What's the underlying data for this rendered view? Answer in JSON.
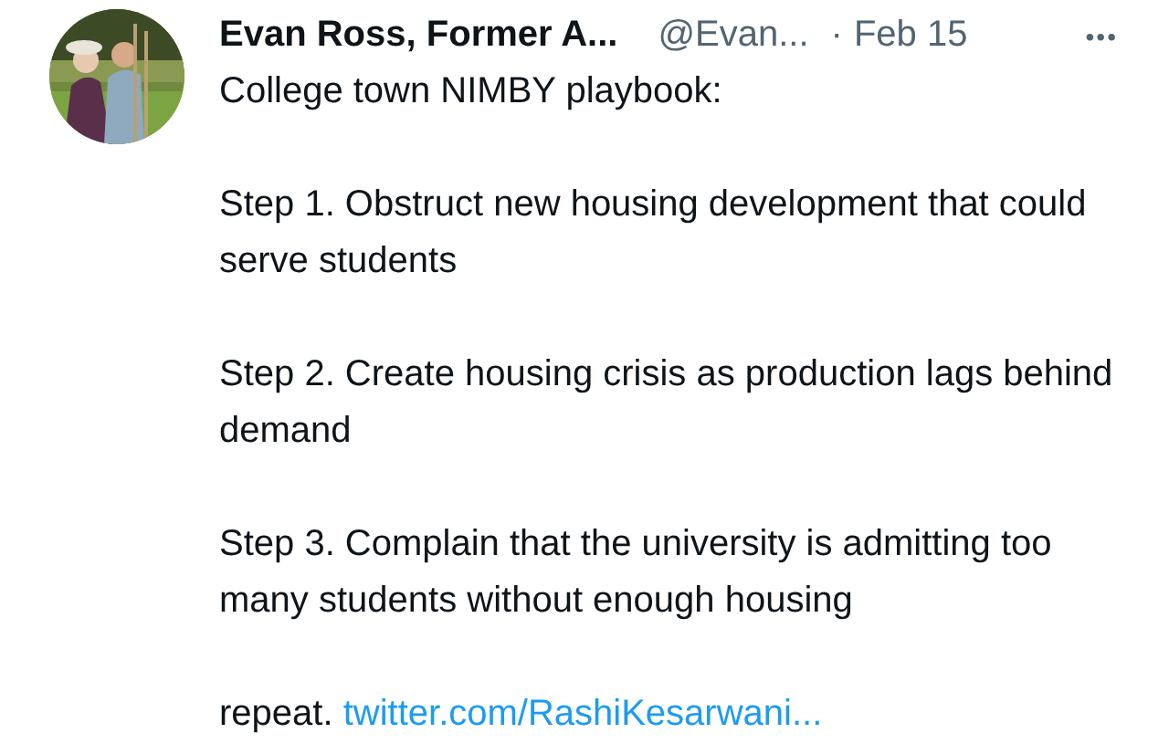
{
  "tweet": {
    "author": {
      "name": "Evan Ross, Former A...",
      "handle": "@Evan...",
      "separator": "·",
      "date": "Feb 15"
    },
    "more": "•••",
    "paragraphs": [
      {
        "text": "College town NIMBY playbook:"
      },
      {
        "text": "Step 1. Obstruct new housing development that could serve students"
      },
      {
        "text": "Step 2. Create housing crisis as production lags behind demand"
      },
      {
        "text": "Step 3. Complain that the university is admitting too many students without enough housing"
      },
      {
        "text": "repeat.",
        "link": "twitter.com/RashiKesarwani..."
      }
    ]
  }
}
